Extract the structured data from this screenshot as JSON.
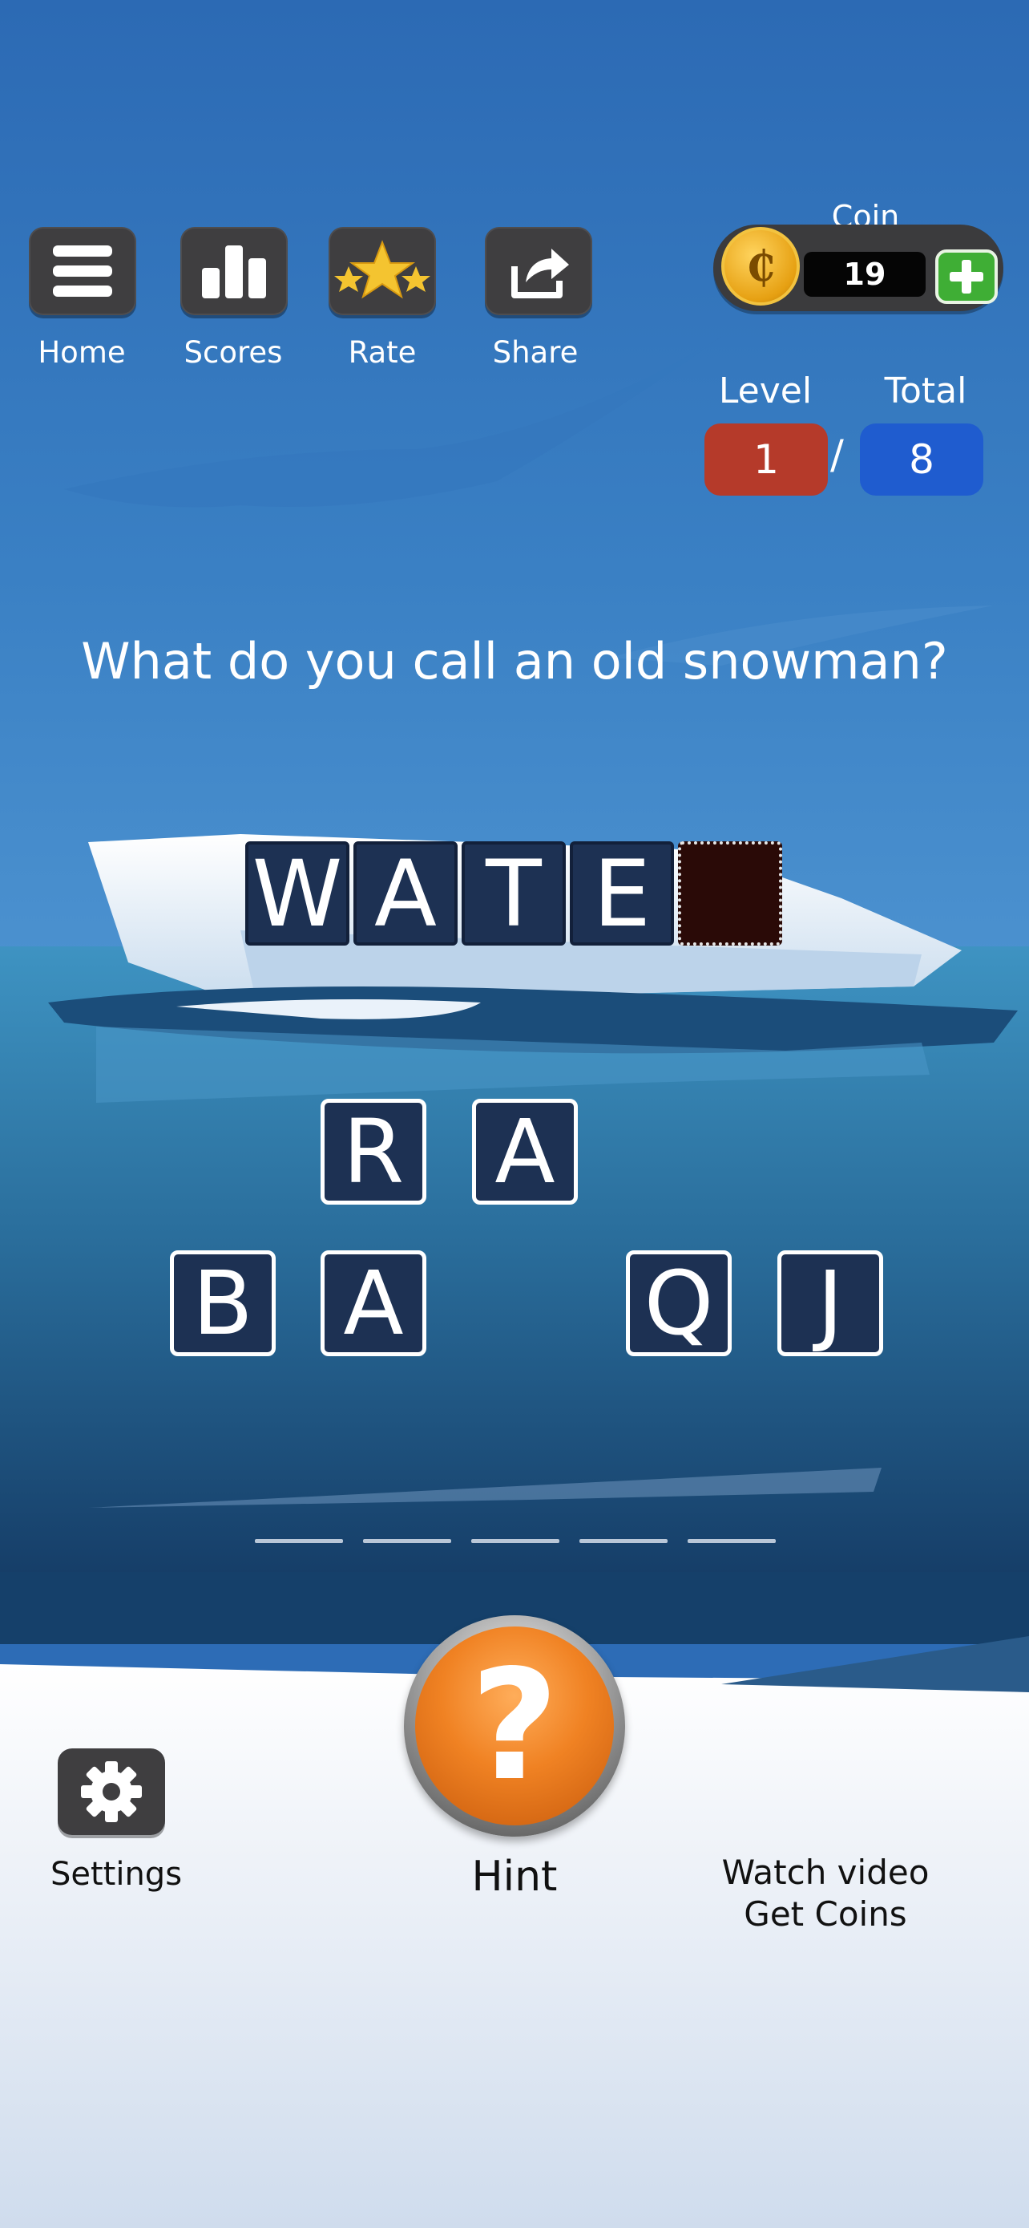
{
  "nav": {
    "home_label": "Home",
    "scores_label": "Scores",
    "rate_label": "Rate",
    "share_label": "Share"
  },
  "coins": {
    "label": "Coin",
    "symbol": "₵",
    "count": "19"
  },
  "progress": {
    "level_label": "Level",
    "total_label": "Total",
    "level": "1",
    "separator": "/",
    "total": "8"
  },
  "question": "What do you call an old snowman?",
  "answer": {
    "letters": [
      "W",
      "A",
      "T",
      "E"
    ],
    "empty_slots": 1
  },
  "letter_pool": {
    "row1": [
      "R",
      "A"
    ],
    "row2": [
      "B",
      "A",
      "Q",
      "J"
    ]
  },
  "bottom": {
    "settings_label": "Settings",
    "hint_symbol": "?",
    "hint_label": "Hint",
    "video_line1": "Watch video",
    "video_line2": "Get Coins"
  },
  "colors": {
    "sky": "#2d6cb6",
    "sea": "#2f7fb0",
    "tile": "#1d3153",
    "level_pill": "#b53a2a",
    "total_pill": "#1f5ccf",
    "hint": "#f08223",
    "plus": "#3fae35"
  }
}
